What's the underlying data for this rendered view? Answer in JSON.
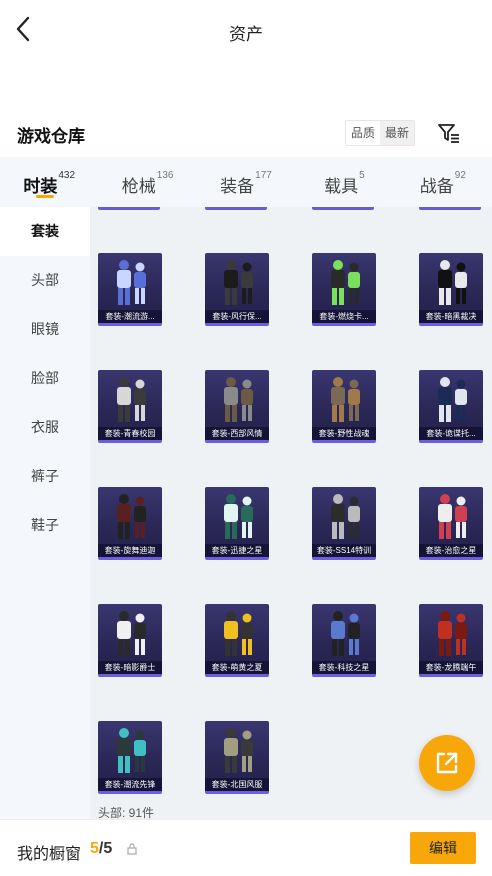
{
  "header": {
    "title": "资产"
  },
  "warehouse": {
    "title": "游戏仓库",
    "sort_options": [
      "品质",
      "最新"
    ],
    "active_sort": "最新"
  },
  "tabs": [
    {
      "label": "时装",
      "count": "432",
      "active": true
    },
    {
      "label": "枪械",
      "count": "136"
    },
    {
      "label": "装备",
      "count": "177"
    },
    {
      "label": "载具",
      "count": "5"
    },
    {
      "label": "战备",
      "count": "92"
    }
  ],
  "sidebar": {
    "items": [
      "套装",
      "头部",
      "眼镜",
      "脸部",
      "衣服",
      "裤子",
      "鞋子"
    ],
    "active": "套装"
  },
  "items": [
    {
      "label": "套装-潮流游..."
    },
    {
      "label": "套装-风行保..."
    },
    {
      "label": "套装-燃烧卡..."
    },
    {
      "label": "套装-暗黑裁决"
    },
    {
      "label": "套装-青春校园"
    },
    {
      "label": "套装-西部风情"
    },
    {
      "label": "套装-野性战魂"
    },
    {
      "label": "套装-诡谍托..."
    },
    {
      "label": "套装-旋舞迪迦"
    },
    {
      "label": "套装-迅捷之星"
    },
    {
      "label": "套装-SS14特训"
    },
    {
      "label": "套装-治愈之星"
    },
    {
      "label": "套装-暗影爵士"
    },
    {
      "label": "套装-萌黄之夏"
    },
    {
      "label": "套装-科技之星"
    },
    {
      "label": "套装-龙腾端午"
    },
    {
      "label": "套装-潮流先锋"
    },
    {
      "label": "套装-北国风服"
    }
  ],
  "section_label": "头部: 91件",
  "bottom": {
    "closet_label": "我的橱窗",
    "closet_current": "5",
    "closet_total": "/5",
    "edit_label": "编辑"
  },
  "colors": {
    "accent": "#f7a70a",
    "card": "#2b2857",
    "card_border": "#6f5ce0"
  },
  "icons": [
    "back-icon",
    "filter-icon",
    "share-icon",
    "lock-icon"
  ]
}
